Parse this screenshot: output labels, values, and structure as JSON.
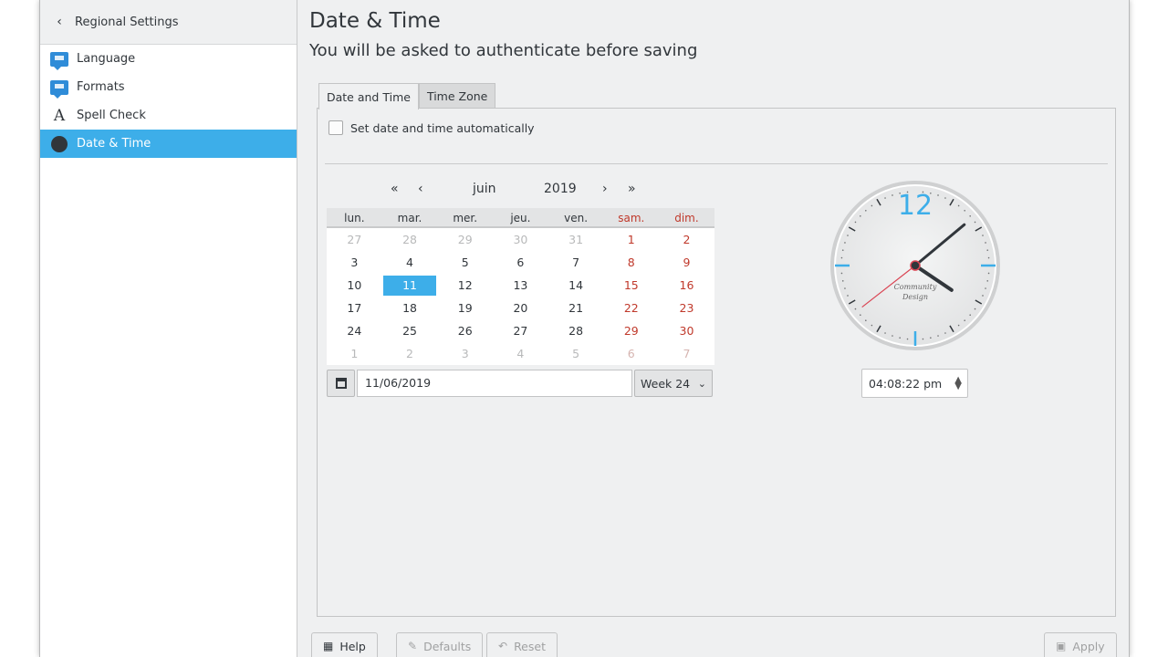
{
  "sidebar": {
    "header": "Regional Settings",
    "items": [
      {
        "label": "Language",
        "icon": "flag-icon"
      },
      {
        "label": "Formats",
        "icon": "flag-icon"
      },
      {
        "label": "Spell Check",
        "icon": "spell-check-icon"
      },
      {
        "label": "Date & Time",
        "icon": "clock-icon",
        "active": true
      }
    ]
  },
  "main": {
    "title": "Date & Time",
    "subtitle": "You will be asked to authenticate before saving",
    "tabs": [
      "Date and Time",
      "Time Zone"
    ],
    "auto_label": "Set date and time automatically",
    "auto_checked": false
  },
  "calendar": {
    "month": "juin",
    "year": "2019",
    "weekdays": [
      "lun.",
      "mar.",
      "mer.",
      "jeu.",
      "ven.",
      "sam.",
      "dim."
    ],
    "weeks": [
      [
        "27",
        "28",
        "29",
        "30",
        "31",
        "1",
        "2"
      ],
      [
        "3",
        "4",
        "5",
        "6",
        "7",
        "8",
        "9"
      ],
      [
        "10",
        "11",
        "12",
        "13",
        "14",
        "15",
        "16"
      ],
      [
        "17",
        "18",
        "19",
        "20",
        "21",
        "22",
        "23"
      ],
      [
        "24",
        "25",
        "26",
        "27",
        "28",
        "29",
        "30"
      ],
      [
        "1",
        "2",
        "3",
        "4",
        "5",
        "6",
        "7"
      ]
    ],
    "selected_day": "11",
    "date_value": "11/06/2019",
    "week_label": "Week 24"
  },
  "clock": {
    "hour_label": "12",
    "brand_line1": "Community",
    "brand_line2": "Design",
    "time_value": "04:08:22 pm",
    "hours": 4,
    "minutes": 8,
    "seconds": 22,
    "accent_color": "#3daee9"
  },
  "buttons": {
    "help": "Help",
    "defaults": "Defaults",
    "reset": "Reset",
    "apply": "Apply"
  }
}
